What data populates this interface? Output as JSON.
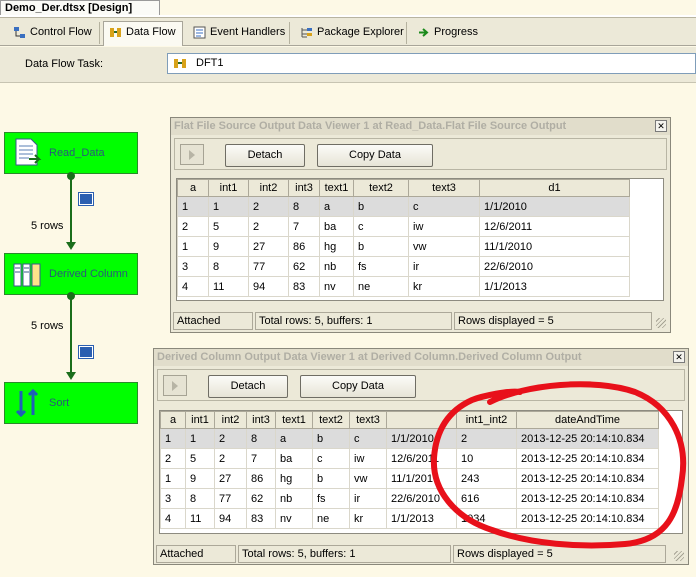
{
  "document_tab": "Demo_Der.dtsx [Design]",
  "tabs": [
    {
      "label": "Control Flow",
      "icon": "control-flow-icon"
    },
    {
      "label": "Data Flow",
      "icon": "data-flow-icon"
    },
    {
      "label": "Event Handlers",
      "icon": "event-handlers-icon"
    },
    {
      "label": "Package Explorer",
      "icon": "package-explorer-icon"
    },
    {
      "label": "Progress",
      "icon": "progress-arrow-icon"
    }
  ],
  "active_tab": "Data Flow",
  "data_flow_task": {
    "label": "Data Flow Task:",
    "value": "DFT1"
  },
  "components": [
    {
      "label": "Read_Data",
      "icon": "flat-file-source-icon"
    },
    {
      "label": "Derived Column",
      "icon": "derived-column-icon"
    },
    {
      "label": "Sort",
      "icon": "sort-icon"
    }
  ],
  "paths": [
    {
      "label": "5 rows",
      "icon": "data-viewer-glasses-icon"
    },
    {
      "label": "5 rows",
      "icon": "data-viewer-glasses-icon"
    }
  ],
  "colors": {
    "component_fill": "#00ff00",
    "path_line": "#1b6e1b",
    "annotation": "#e8101a"
  },
  "viewer1": {
    "title": "Flat File Source Output Data Viewer 1 at Read_Data.Flat File Source Output",
    "detach": "Detach",
    "copy": "Copy Data",
    "columns": [
      "a",
      "int1",
      "int2",
      "int3",
      "text1",
      "text2",
      "text3",
      "d1"
    ],
    "rows": [
      [
        "1",
        "1",
        "2",
        "8",
        "a",
        "b",
        "c",
        "1/1/2010"
      ],
      [
        "2",
        "5",
        "2",
        "7",
        "ba",
        "c",
        "iw",
        "12/6/2011"
      ],
      [
        "1",
        "9",
        "27",
        "86",
        "hg",
        "b",
        "vw",
        "11/1/2010"
      ],
      [
        "3",
        "8",
        "77",
        "62",
        "nb",
        "fs",
        "ir",
        "22/6/2010"
      ],
      [
        "4",
        "11",
        "94",
        "83",
        "nv",
        "ne",
        "kr",
        "1/1/2013"
      ]
    ],
    "status": {
      "state": "Attached",
      "totals": "Total rows: 5, buffers: 1",
      "displayed": "Rows displayed = 5"
    }
  },
  "viewer2": {
    "title": "Derived Column Output Data Viewer 1 at Derived Column.Derived Column Output",
    "detach": "Detach",
    "copy": "Copy Data",
    "columns": [
      "a",
      "int1",
      "int2",
      "int3",
      "text1",
      "text2",
      "text3",
      "",
      "int1_int2",
      "dateAndTime"
    ],
    "rows": [
      [
        "1",
        "1",
        "2",
        "8",
        "a",
        "b",
        "c",
        "1/1/2010",
        "2",
        "2013-12-25 20:14:10.834"
      ],
      [
        "2",
        "5",
        "2",
        "7",
        "ba",
        "c",
        "iw",
        "12/6/2011",
        "10",
        "2013-12-25 20:14:10.834"
      ],
      [
        "1",
        "9",
        "27",
        "86",
        "hg",
        "b",
        "vw",
        "11/1/2010",
        "243",
        "2013-12-25 20:14:10.834"
      ],
      [
        "3",
        "8",
        "77",
        "62",
        "nb",
        "fs",
        "ir",
        "22/6/2010",
        "616",
        "2013-12-25 20:14:10.834"
      ],
      [
        "4",
        "11",
        "94",
        "83",
        "nv",
        "ne",
        "kr",
        "1/1/2013",
        "1034",
        "2013-12-25 20:14:10.834"
      ]
    ],
    "status": {
      "state": "Attached",
      "totals": "Total rows: 5, buffers: 1",
      "displayed": "Rows displayed = 5"
    }
  }
}
